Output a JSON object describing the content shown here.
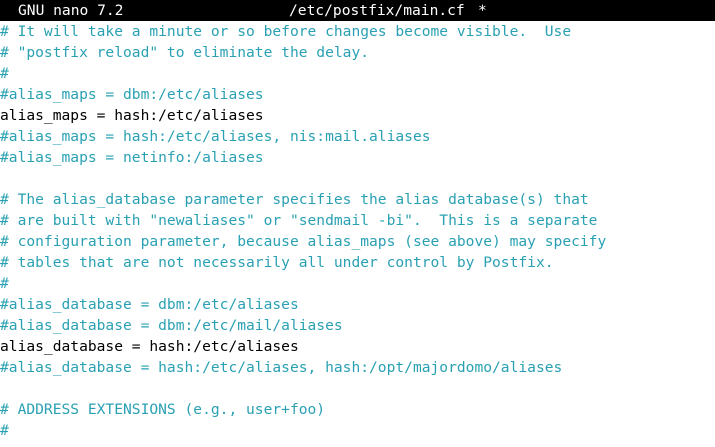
{
  "header": {
    "app_version": "GNU nano 7.2",
    "file_path": "/etc/postfix/main.cf",
    "modified_marker": "*"
  },
  "colors": {
    "title_bar_bg": "#000000",
    "title_bar_fg": "#ffffff",
    "comment": "#2aa1b3",
    "code": "#000000",
    "background": "#ffffff"
  },
  "editor": {
    "lines": [
      {
        "text": "# It will take a minute or so before changes become visible.  Use",
        "kind": "comment"
      },
      {
        "text": "# \"postfix reload\" to eliminate the delay.",
        "kind": "comment"
      },
      {
        "text": "#",
        "kind": "comment"
      },
      {
        "text": "#alias_maps = dbm:/etc/aliases",
        "kind": "comment"
      },
      {
        "text": "alias_maps = hash:/etc/aliases",
        "kind": "code"
      },
      {
        "text": "#alias_maps = hash:/etc/aliases, nis:mail.aliases",
        "kind": "comment"
      },
      {
        "text": "#alias_maps = netinfo:/aliases",
        "kind": "comment"
      },
      {
        "text": "",
        "kind": "blank"
      },
      {
        "text": "# The alias_database parameter specifies the alias database(s) that",
        "kind": "comment"
      },
      {
        "text": "# are built with \"newaliases\" or \"sendmail -bi\".  This is a separate",
        "kind": "comment"
      },
      {
        "text": "# configuration parameter, because alias_maps (see above) may specify",
        "kind": "comment"
      },
      {
        "text": "# tables that are not necessarily all under control by Postfix.",
        "kind": "comment"
      },
      {
        "text": "#",
        "kind": "comment"
      },
      {
        "text": "#alias_database = dbm:/etc/aliases",
        "kind": "comment"
      },
      {
        "text": "#alias_database = dbm:/etc/mail/aliases",
        "kind": "comment"
      },
      {
        "text": "alias_database = hash:/etc/aliases",
        "kind": "code"
      },
      {
        "text": "#alias_database = hash:/etc/aliases, hash:/opt/majordomo/aliases",
        "kind": "comment"
      },
      {
        "text": "",
        "kind": "blank"
      },
      {
        "text": "# ADDRESS EXTENSIONS (e.g., user+foo)",
        "kind": "comment"
      },
      {
        "text": "#",
        "kind": "comment"
      }
    ]
  }
}
